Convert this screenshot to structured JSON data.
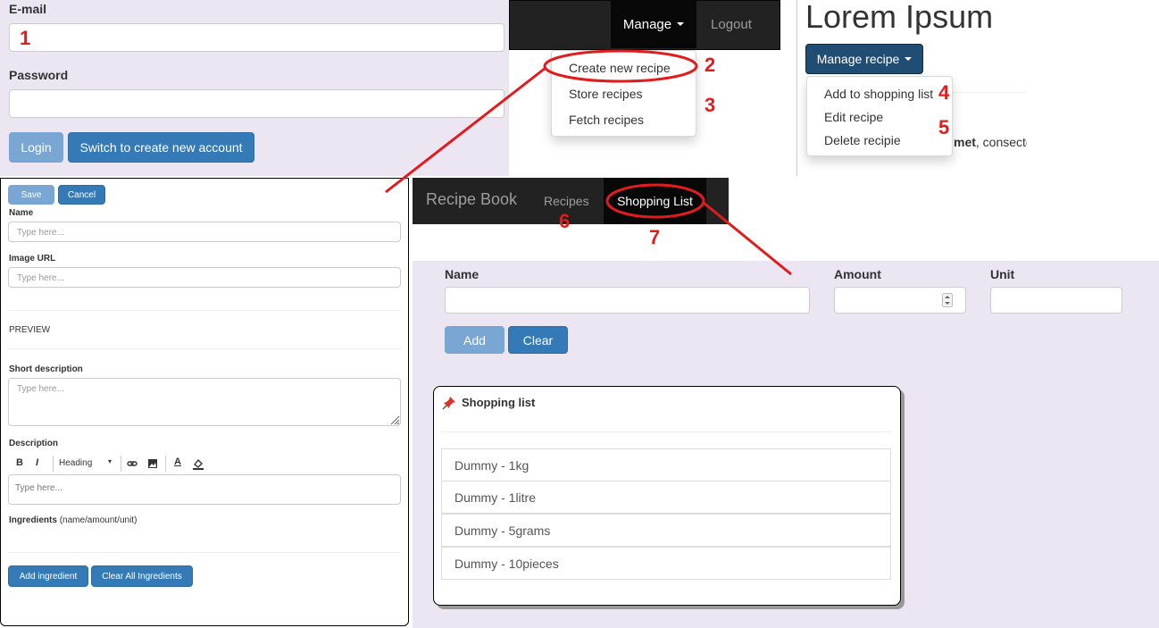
{
  "login": {
    "email_label": "E-mail",
    "password_label": "Password",
    "login_btn": "Login",
    "switch_btn": "Switch to create new account"
  },
  "topnav": {
    "manage": "Manage",
    "logout": "Logout"
  },
  "manage_menu": [
    "Create new recipe",
    "Store recipes",
    "Fetch recipes"
  ],
  "detail": {
    "title": "Lorem Ipsum",
    "manage_recipe": "Manage recipe",
    "menu": [
      "Add to shopping list",
      "Edit recipe",
      "Delete recipie"
    ],
    "partial_bold": "met",
    "partial_text": ", consecte"
  },
  "editor": {
    "save": "Save",
    "cancel": "Cancel",
    "name_label": "Name",
    "name_ph": "Type here...",
    "image_label": "Image URL",
    "image_ph": "Type here...",
    "preview": "PREVIEW",
    "short_label": "Short description",
    "short_ph": "Type here...",
    "desc_label": "Description",
    "heading": "Heading",
    "desc_ph": "Type here...",
    "ingr_label": "Ingredients",
    "ingr_hint": "(name/amount/unit)",
    "add_ingr": "Add ingredient",
    "clear_ingr": "Clear All Ingredients",
    "toolbar_bold": "B",
    "toolbar_italic": "I",
    "toolbar_color": "A"
  },
  "recipebook": {
    "brand": "Recipe Book",
    "recipes": "Recipes",
    "shopping": "Shopping List"
  },
  "shopping": {
    "name_label": "Name",
    "amount_label": "Amount",
    "unit_label": "Unit",
    "add": "Add",
    "clear": "Clear",
    "panel_title": "Shopping list",
    "items": [
      "Dummy - 1kg",
      "Dummy - 1litre",
      "Dummy - 5grams",
      "Dummy - 10pieces"
    ]
  },
  "annotations": [
    "1",
    "2",
    "3",
    "4",
    "5",
    "6",
    "7"
  ],
  "colors": {
    "primary": "#337ab7",
    "dark_nav": "#222222",
    "lavender": "#ebe6f2",
    "annotation_red": "#e21c1c"
  }
}
